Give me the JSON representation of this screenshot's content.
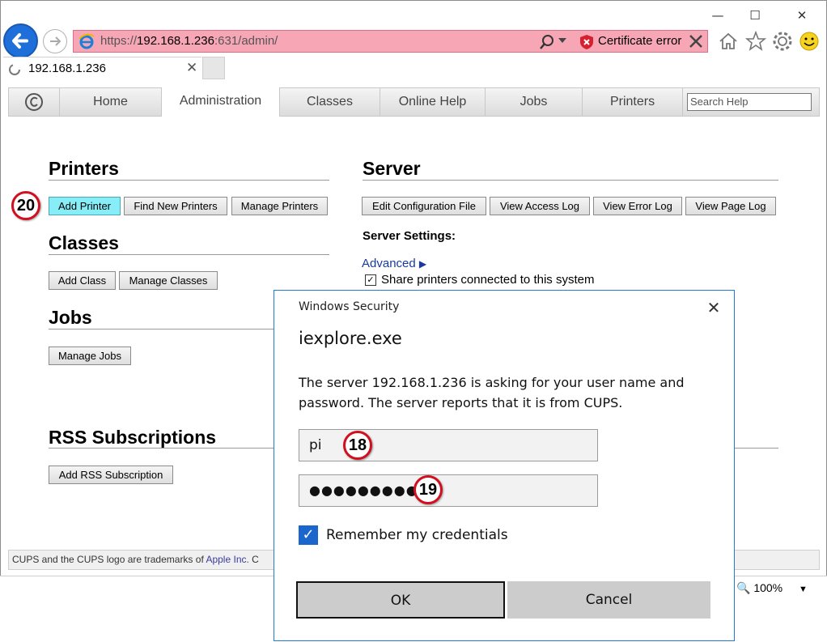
{
  "browser": {
    "url_scheme": "https://",
    "url_host": "192.168.1.236",
    "url_rest": ":631/admin/",
    "cert_error": "Certificate error",
    "tab_title": "192.168.1.236",
    "zoom": "100%",
    "address_bar_color": "#f7a6b5"
  },
  "nav": {
    "tabs": [
      {
        "label": "Home"
      },
      {
        "label": "Administration"
      },
      {
        "label": "Classes"
      },
      {
        "label": "Online Help"
      },
      {
        "label": "Jobs"
      },
      {
        "label": "Printers"
      }
    ],
    "search_placeholder": "Search Help"
  },
  "admin": {
    "printers": {
      "heading": "Printers",
      "buttons": [
        "Add Printer",
        "Find New Printers",
        "Manage Printers"
      ]
    },
    "classes": {
      "heading": "Classes",
      "buttons": [
        "Add Class",
        "Manage Classes"
      ]
    },
    "jobs": {
      "heading": "Jobs",
      "buttons": [
        "Manage Jobs"
      ]
    },
    "rss": {
      "heading": "RSS Subscriptions",
      "buttons": [
        "Add RSS Subscription"
      ]
    },
    "server": {
      "heading": "Server",
      "buttons": [
        "Edit Configuration File",
        "View Access Log",
        "View Error Log",
        "View Page Log"
      ],
      "settings_label": "Server Settings:",
      "advanced": "Advanced",
      "share_label": "Share printers connected to this system"
    }
  },
  "footer": {
    "text": "CUPS and the CUPS logo are trademarks of ",
    "link": "Apple Inc.",
    "tail": " C"
  },
  "annotations": {
    "add_printer": "20",
    "username": "18",
    "password": "19",
    "badge_color": "#d10f1f"
  },
  "dialog": {
    "title": "Windows Security",
    "app": "iexplore.exe",
    "message": "The server 192.168.1.236 is asking for your user name and password. The server reports that it is from CUPS.",
    "username": "pi",
    "password_mask": "●●●●●●●●●",
    "remember": "Remember my credentials",
    "ok": "OK",
    "cancel": "Cancel",
    "accent": "#1a66cc"
  }
}
